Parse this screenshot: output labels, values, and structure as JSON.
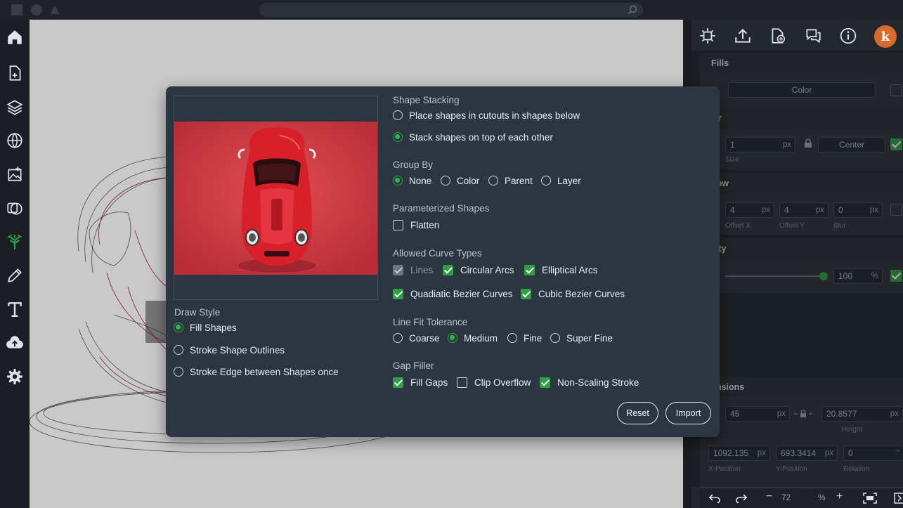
{
  "colors": {
    "accent": "#2f9e44",
    "dialog_bg": "#2c3640",
    "panel_bg": "#23282d",
    "avatar": "#d96a2e",
    "preview_bg": "#d43f47"
  },
  "search": {
    "placeholder": ""
  },
  "left_tools": [
    "home-icon",
    "new-document-icon",
    "layers-icon",
    "globe-icon",
    "image-import-icon",
    "shapes-icon",
    "tree-icon",
    "pencil-icon",
    "text-icon",
    "cloud-upload-icon",
    "settings-icon"
  ],
  "right_panel": {
    "avatar_letter": "k",
    "fills": {
      "title": "Fills",
      "color_select": "Color"
    },
    "border": {
      "title": "ler",
      "size_value": "1",
      "size_unit": "px",
      "size_label": "Size",
      "align": "Center"
    },
    "shadow": {
      "title": "dow",
      "offset_x": "4",
      "offset_y": "4",
      "blur": "0",
      "unit": "px",
      "offset_x_label": "Offset X",
      "offset_y_label": "Offset Y",
      "blur_label": "Blur"
    },
    "opacity": {
      "title": "city",
      "value": "100",
      "unit": "%"
    },
    "dimensions": {
      "title": "ensions",
      "width": "45",
      "height": "20.8577",
      "unit": "px",
      "height_label": "Height",
      "x": "1092.135",
      "y": "693.3414",
      "rotation": "0",
      "rotation_unit": "°",
      "x_label": "X-Position",
      "y_label": "Y-Position",
      "rotation_label": "Rotation"
    },
    "zoom": {
      "value": "72",
      "unit": "%"
    }
  },
  "dialog": {
    "draw_style": {
      "title": "Draw Style",
      "options": [
        "Fill Shapes",
        "Stroke Shape Outlines",
        "Stroke Edge between Shapes once"
      ],
      "selected": 0
    },
    "shape_stacking": {
      "title": "Shape Stacking",
      "options": [
        "Place shapes in cutouts in shapes below",
        "Stack shapes on top of each other"
      ],
      "selected": 1
    },
    "group_by": {
      "title": "Group By",
      "options": [
        "None",
        "Color",
        "Parent",
        "Layer"
      ],
      "selected": 0
    },
    "parameterized": {
      "title": "Parameterized Shapes",
      "flatten": "Flatten",
      "flatten_checked": false
    },
    "curve_types": {
      "title": "Allowed Curve Types",
      "lines": "Lines",
      "circular_arcs": "Circular Arcs",
      "elliptical_arcs": "Elliptical Arcs",
      "quadratic": "Quadiatic Bezier Curves",
      "cubic": "Cubic Bezier Curves"
    },
    "tolerance": {
      "title": "Line Fit Tolerance",
      "options": [
        "Coarse",
        "Medium",
        "Fine",
        "Super Fine"
      ],
      "selected": 1
    },
    "gap_filler": {
      "title": "Gap Filler",
      "fill_gaps": "Fill Gaps",
      "clip_overflow": "Clip Overflow",
      "non_scaling": "Non-Scaling Stroke"
    },
    "reset_label": "Reset",
    "import_label": "Import"
  }
}
